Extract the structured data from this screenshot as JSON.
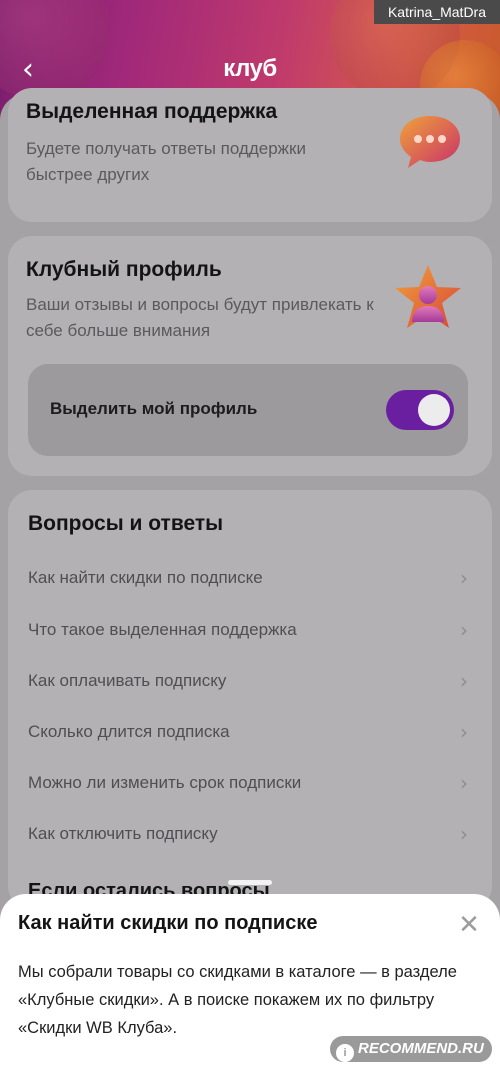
{
  "header": {
    "logo": "клуб",
    "back_glyph": "‹"
  },
  "watermark_top": "Katrina_MatDra",
  "cards": {
    "support": {
      "title": "Выделенная поддержка",
      "subtitle": "Будете получать ответы поддержки быстрее других",
      "icon": "chat-bubble-icon"
    },
    "profile": {
      "title": "Клубный профиль",
      "subtitle": "Ваши отзывы и вопросы будут привлекать к себе больше внимания",
      "icon": "star-person-icon",
      "toggle_label": "Выделить мой профиль",
      "toggle_on": true
    }
  },
  "faq": {
    "title": "Вопросы и ответы",
    "items": [
      "Как найти скидки по подписке",
      "Что такое выделенная поддержка",
      "Как оплачивать подписку",
      "Сколько длится подписка",
      "Можно ли изменить срок подписки",
      "Как отключить подписку"
    ],
    "next_section_peek": "Если остались вопросы"
  },
  "bottom_sheet": {
    "title": "Как найти скидки по подписке",
    "body": "Мы собрали товары со скидками в каталоге — в разделе «Клубные скидки». А в поиске покажем их по фильтру «Скидки WB Клуба».",
    "close_glyph": "✕"
  },
  "watermark_bottom": {
    "circle": "i",
    "text": "RECOMMEND.RU"
  },
  "colors": {
    "toggle_accent": "#6a1fa0",
    "hero_gradient_start": "#7a1d6e",
    "hero_gradient_end": "#c85a2a"
  }
}
